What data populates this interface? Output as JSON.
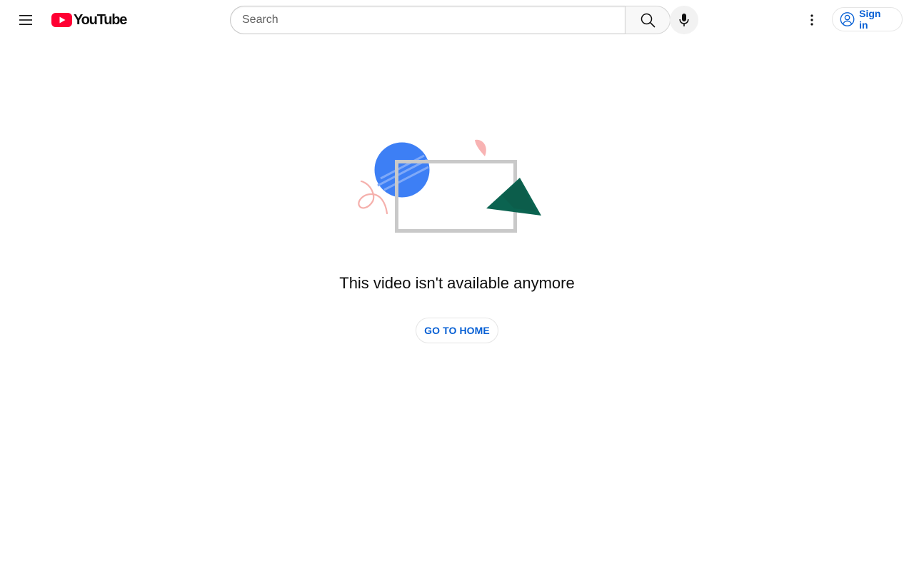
{
  "header": {
    "logo_text": "YouTube",
    "search_placeholder": "Search",
    "search_value": "",
    "sign_in_label": "Sign in",
    "brand_color": "#ff0033",
    "link_color": "#065fd4"
  },
  "icons": {
    "menu": "hamburger-menu-icon",
    "search": "search-icon",
    "mic": "microphone-icon",
    "more": "more-vertical-icon",
    "account": "account-circle-icon"
  },
  "error": {
    "message": "This video isn't available anymore",
    "button_label": "GO TO HOME"
  }
}
